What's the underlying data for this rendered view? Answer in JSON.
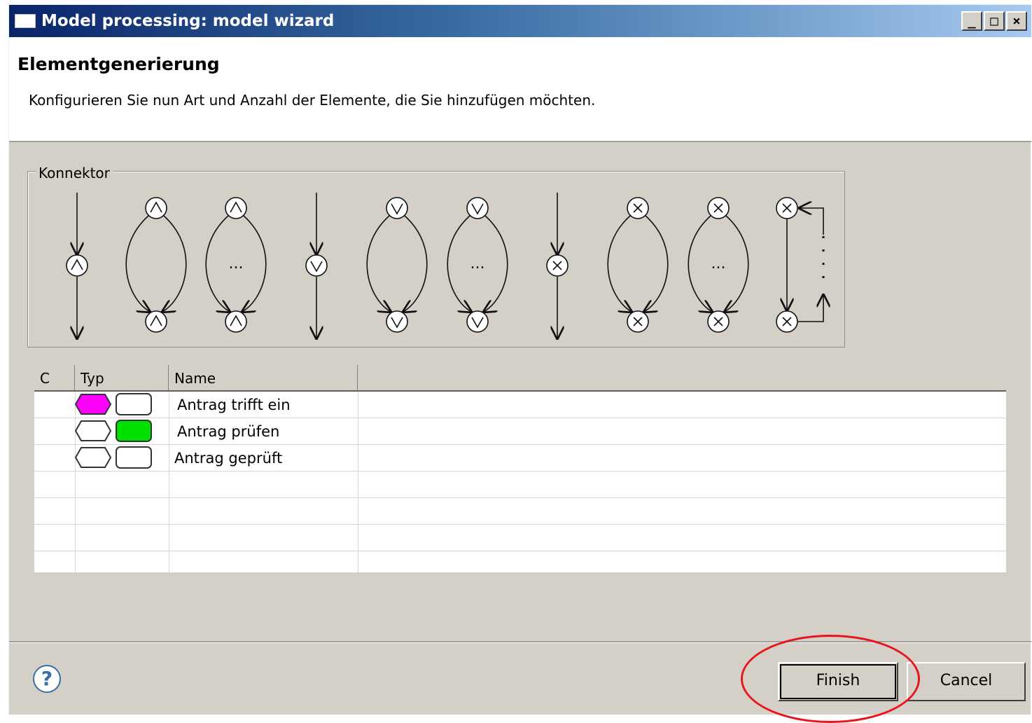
{
  "window": {
    "title": "Model processing: model wizard",
    "buttons": {
      "minimize": "_",
      "maximize": "□",
      "close": "×"
    }
  },
  "header": {
    "title": "Elementgenerierung",
    "description": "Konfigurieren Sie nun Art und Anzahl der Elemente, die Sie hinzufügen möchten."
  },
  "connector_group": {
    "label": "Konnektor",
    "dots": "...",
    "items": [
      "and-sequence-icon",
      "and-split-join-icon",
      "and-split-join-multi-icon",
      "or-sequence-icon",
      "or-split-join-icon",
      "or-split-join-multi-icon",
      "xor-sequence-icon",
      "xor-split-join-icon",
      "xor-split-join-multi-icon",
      "xor-loop-icon"
    ]
  },
  "table": {
    "columns": [
      "C",
      "Typ",
      "Name"
    ],
    "rows": [
      {
        "name": "Antrag trifft ein",
        "hex_color": "#ff00ff",
        "box_color": "#ffffff"
      },
      {
        "name": "Antrag prüfen",
        "hex_color": "#ffffff",
        "box_color": "#00e000"
      },
      {
        "name": "Antrag geprüft",
        "hex_color": "#ffffff",
        "box_color": "#ffffff"
      }
    ]
  },
  "footer": {
    "help": "?",
    "finish_label": "Finish",
    "cancel_label": "Cancel"
  }
}
